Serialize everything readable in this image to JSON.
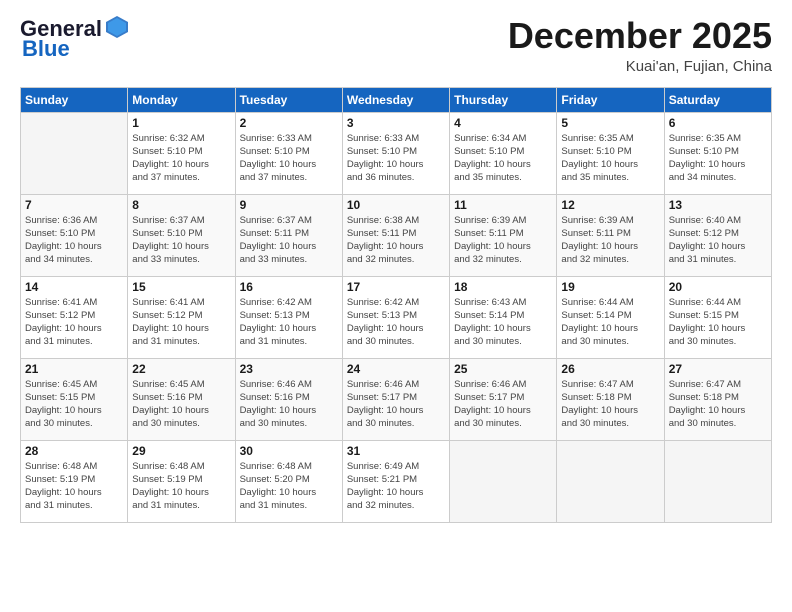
{
  "header": {
    "logo_general": "General",
    "logo_blue": "Blue",
    "title": "December 2025",
    "subtitle": "Kuai'an, Fujian, China"
  },
  "calendar": {
    "days_of_week": [
      "Sunday",
      "Monday",
      "Tuesday",
      "Wednesday",
      "Thursday",
      "Friday",
      "Saturday"
    ],
    "weeks": [
      [
        {
          "day": "",
          "sunrise": "",
          "sunset": "",
          "daylight": ""
        },
        {
          "day": "1",
          "sunrise": "Sunrise: 6:32 AM",
          "sunset": "Sunset: 5:10 PM",
          "daylight": "Daylight: 10 hours and 37 minutes."
        },
        {
          "day": "2",
          "sunrise": "Sunrise: 6:33 AM",
          "sunset": "Sunset: 5:10 PM",
          "daylight": "Daylight: 10 hours and 37 minutes."
        },
        {
          "day": "3",
          "sunrise": "Sunrise: 6:33 AM",
          "sunset": "Sunset: 5:10 PM",
          "daylight": "Daylight: 10 hours and 36 minutes."
        },
        {
          "day": "4",
          "sunrise": "Sunrise: 6:34 AM",
          "sunset": "Sunset: 5:10 PM",
          "daylight": "Daylight: 10 hours and 35 minutes."
        },
        {
          "day": "5",
          "sunrise": "Sunrise: 6:35 AM",
          "sunset": "Sunset: 5:10 PM",
          "daylight": "Daylight: 10 hours and 35 minutes."
        },
        {
          "day": "6",
          "sunrise": "Sunrise: 6:35 AM",
          "sunset": "Sunset: 5:10 PM",
          "daylight": "Daylight: 10 hours and 34 minutes."
        }
      ],
      [
        {
          "day": "7",
          "sunrise": "Sunrise: 6:36 AM",
          "sunset": "Sunset: 5:10 PM",
          "daylight": "Daylight: 10 hours and 34 minutes."
        },
        {
          "day": "8",
          "sunrise": "Sunrise: 6:37 AM",
          "sunset": "Sunset: 5:10 PM",
          "daylight": "Daylight: 10 hours and 33 minutes."
        },
        {
          "day": "9",
          "sunrise": "Sunrise: 6:37 AM",
          "sunset": "Sunset: 5:11 PM",
          "daylight": "Daylight: 10 hours and 33 minutes."
        },
        {
          "day": "10",
          "sunrise": "Sunrise: 6:38 AM",
          "sunset": "Sunset: 5:11 PM",
          "daylight": "Daylight: 10 hours and 32 minutes."
        },
        {
          "day": "11",
          "sunrise": "Sunrise: 6:39 AM",
          "sunset": "Sunset: 5:11 PM",
          "daylight": "Daylight: 10 hours and 32 minutes."
        },
        {
          "day": "12",
          "sunrise": "Sunrise: 6:39 AM",
          "sunset": "Sunset: 5:11 PM",
          "daylight": "Daylight: 10 hours and 32 minutes."
        },
        {
          "day": "13",
          "sunrise": "Sunrise: 6:40 AM",
          "sunset": "Sunset: 5:12 PM",
          "daylight": "Daylight: 10 hours and 31 minutes."
        }
      ],
      [
        {
          "day": "14",
          "sunrise": "Sunrise: 6:41 AM",
          "sunset": "Sunset: 5:12 PM",
          "daylight": "Daylight: 10 hours and 31 minutes."
        },
        {
          "day": "15",
          "sunrise": "Sunrise: 6:41 AM",
          "sunset": "Sunset: 5:12 PM",
          "daylight": "Daylight: 10 hours and 31 minutes."
        },
        {
          "day": "16",
          "sunrise": "Sunrise: 6:42 AM",
          "sunset": "Sunset: 5:13 PM",
          "daylight": "Daylight: 10 hours and 31 minutes."
        },
        {
          "day": "17",
          "sunrise": "Sunrise: 6:42 AM",
          "sunset": "Sunset: 5:13 PM",
          "daylight": "Daylight: 10 hours and 30 minutes."
        },
        {
          "day": "18",
          "sunrise": "Sunrise: 6:43 AM",
          "sunset": "Sunset: 5:14 PM",
          "daylight": "Daylight: 10 hours and 30 minutes."
        },
        {
          "day": "19",
          "sunrise": "Sunrise: 6:44 AM",
          "sunset": "Sunset: 5:14 PM",
          "daylight": "Daylight: 10 hours and 30 minutes."
        },
        {
          "day": "20",
          "sunrise": "Sunrise: 6:44 AM",
          "sunset": "Sunset: 5:15 PM",
          "daylight": "Daylight: 10 hours and 30 minutes."
        }
      ],
      [
        {
          "day": "21",
          "sunrise": "Sunrise: 6:45 AM",
          "sunset": "Sunset: 5:15 PM",
          "daylight": "Daylight: 10 hours and 30 minutes."
        },
        {
          "day": "22",
          "sunrise": "Sunrise: 6:45 AM",
          "sunset": "Sunset: 5:16 PM",
          "daylight": "Daylight: 10 hours and 30 minutes."
        },
        {
          "day": "23",
          "sunrise": "Sunrise: 6:46 AM",
          "sunset": "Sunset: 5:16 PM",
          "daylight": "Daylight: 10 hours and 30 minutes."
        },
        {
          "day": "24",
          "sunrise": "Sunrise: 6:46 AM",
          "sunset": "Sunset: 5:17 PM",
          "daylight": "Daylight: 10 hours and 30 minutes."
        },
        {
          "day": "25",
          "sunrise": "Sunrise: 6:46 AM",
          "sunset": "Sunset: 5:17 PM",
          "daylight": "Daylight: 10 hours and 30 minutes."
        },
        {
          "day": "26",
          "sunrise": "Sunrise: 6:47 AM",
          "sunset": "Sunset: 5:18 PM",
          "daylight": "Daylight: 10 hours and 30 minutes."
        },
        {
          "day": "27",
          "sunrise": "Sunrise: 6:47 AM",
          "sunset": "Sunset: 5:18 PM",
          "daylight": "Daylight: 10 hours and 30 minutes."
        }
      ],
      [
        {
          "day": "28",
          "sunrise": "Sunrise: 6:48 AM",
          "sunset": "Sunset: 5:19 PM",
          "daylight": "Daylight: 10 hours and 31 minutes."
        },
        {
          "day": "29",
          "sunrise": "Sunrise: 6:48 AM",
          "sunset": "Sunset: 5:19 PM",
          "daylight": "Daylight: 10 hours and 31 minutes."
        },
        {
          "day": "30",
          "sunrise": "Sunrise: 6:48 AM",
          "sunset": "Sunset: 5:20 PM",
          "daylight": "Daylight: 10 hours and 31 minutes."
        },
        {
          "day": "31",
          "sunrise": "Sunrise: 6:49 AM",
          "sunset": "Sunset: 5:21 PM",
          "daylight": "Daylight: 10 hours and 32 minutes."
        },
        {
          "day": "",
          "sunrise": "",
          "sunset": "",
          "daylight": ""
        },
        {
          "day": "",
          "sunrise": "",
          "sunset": "",
          "daylight": ""
        },
        {
          "day": "",
          "sunrise": "",
          "sunset": "",
          "daylight": ""
        }
      ]
    ]
  }
}
